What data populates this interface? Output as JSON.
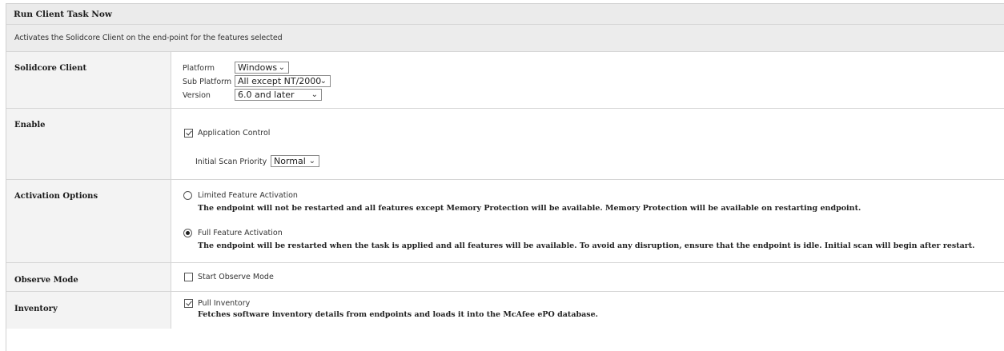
{
  "header": {
    "title": "Run Client Task Now",
    "description": "Activates the Solidcore Client on the end-point for the features selected"
  },
  "solidcore_client": {
    "label": "Solidcore Client",
    "platform_label": "Platform",
    "platform_value": "Windows",
    "sub_platform_label": "Sub Platform",
    "sub_platform_value": "All except NT/2000",
    "version_label": "Version",
    "version_value": "6.0 and later"
  },
  "enable": {
    "label": "Enable",
    "application_control_label": "Application Control",
    "application_control_checked": true,
    "scan_priority_label": "Initial Scan Priority",
    "scan_priority_value": "Normal"
  },
  "activation_options": {
    "label": "Activation Options",
    "limited_label": "Limited Feature Activation",
    "limited_desc": "The endpoint will not be restarted and all features except Memory Protection will be available. Memory Protection will be available on restarting endpoint.",
    "full_label": "Full Feature Activation",
    "full_desc": "The endpoint will be restarted when the task is applied and all features will be available. To avoid any disruption, ensure that the endpoint is idle. Initial scan will begin after restart.",
    "selected": "full"
  },
  "observe_mode": {
    "label": "Observe Mode",
    "start_label": "Start Observe Mode",
    "checked": false
  },
  "inventory": {
    "label": "Inventory",
    "pull_label": "Pull Inventory",
    "pull_checked": true,
    "pull_desc": "Fetches software inventory details from endpoints and loads it into the McAfee ePO database."
  }
}
